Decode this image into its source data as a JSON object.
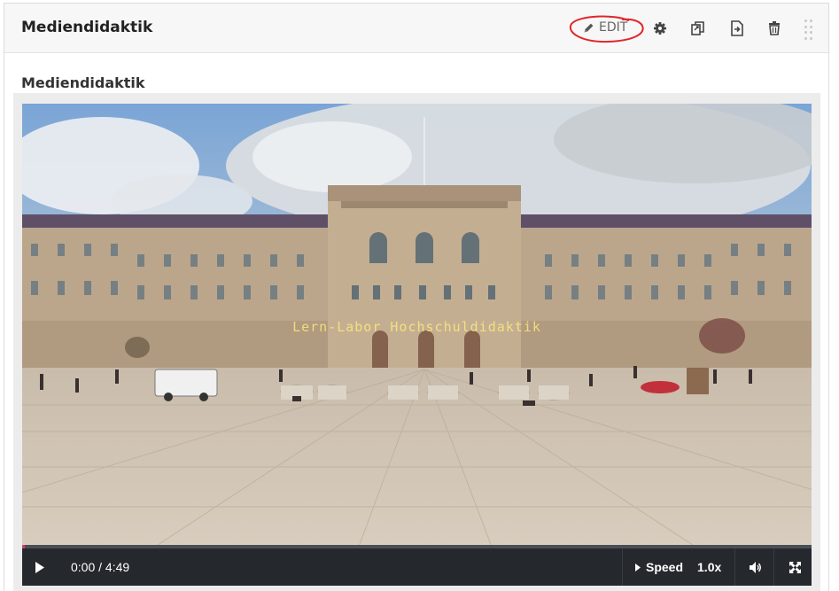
{
  "panel": {
    "title": "Mediendidaktik",
    "toolbar": {
      "edit_label": "EDIT",
      "icons": [
        "pencil-icon",
        "gear-icon",
        "copy-icon",
        "export-icon",
        "trash-icon",
        "drag-handle-icon"
      ]
    }
  },
  "content": {
    "heading": "Mediendidaktik"
  },
  "video": {
    "overlay_text": "Lern-Labor Hochschuldidaktik",
    "progress": 0.0,
    "current_time": "0:00",
    "duration": "4:49",
    "time_display": "0:00 / 4:49",
    "speed_label": "Speed",
    "speed_value": "1.0x",
    "icons": [
      "play-icon",
      "caret-right-icon",
      "volume-icon",
      "fullscreen-icon"
    ]
  },
  "colors": {
    "controls_bg": "#25282d",
    "progress_played": "#d63b6b",
    "edit_annotation": "#e0262b",
    "header_bg": "#f7f7f7"
  }
}
